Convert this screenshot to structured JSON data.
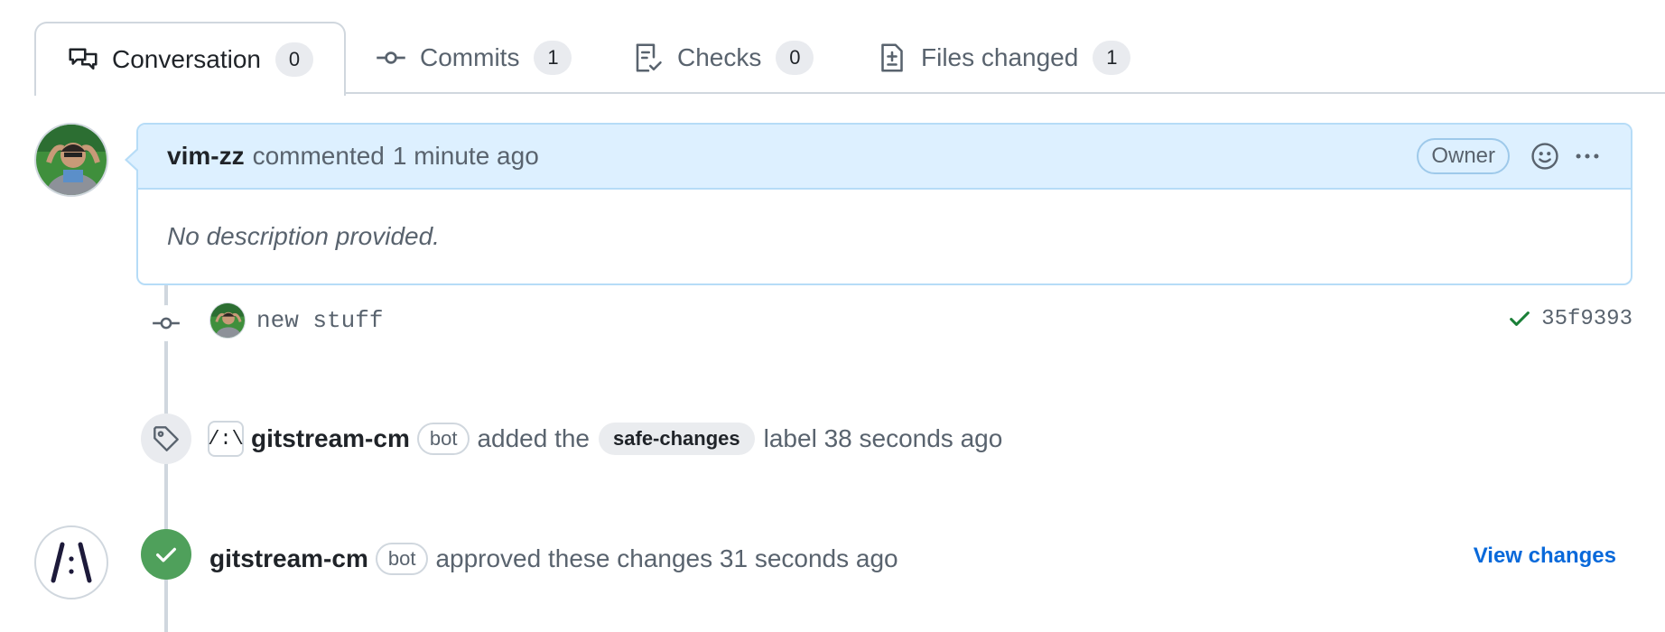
{
  "tabs": [
    {
      "label": "Conversation",
      "count": "0",
      "icon": "comment-discussion-icon",
      "active": true
    },
    {
      "label": "Commits",
      "count": "1",
      "icon": "git-commit-icon"
    },
    {
      "label": "Checks",
      "count": "0",
      "icon": "checklist-icon"
    },
    {
      "label": "Files changed",
      "count": "1",
      "icon": "file-diff-icon"
    }
  ],
  "comment": {
    "author": "vim-zz",
    "action": "commented",
    "time": "1 minute ago",
    "role_badge": "Owner",
    "body": "No description provided."
  },
  "commit": {
    "message": "new stuff",
    "sha": "35f9393",
    "status": "success"
  },
  "label_event": {
    "bot_avatar_text": "/:\\",
    "actor": "gitstream-cm",
    "bot_badge": "bot",
    "text_before": "added the",
    "label": "safe-changes",
    "text_after": "label 38 seconds ago"
  },
  "review_event": {
    "bot_avatar_text": "/:\\",
    "actor": "gitstream-cm",
    "bot_badge": "bot",
    "text": "approved these changes 31 seconds ago",
    "link": "View changes"
  },
  "colors": {
    "accent_blue": "#0969da",
    "success_green": "#4fa05b",
    "comment_header_bg": "#ddf0ff",
    "border": "#d0d7de"
  }
}
